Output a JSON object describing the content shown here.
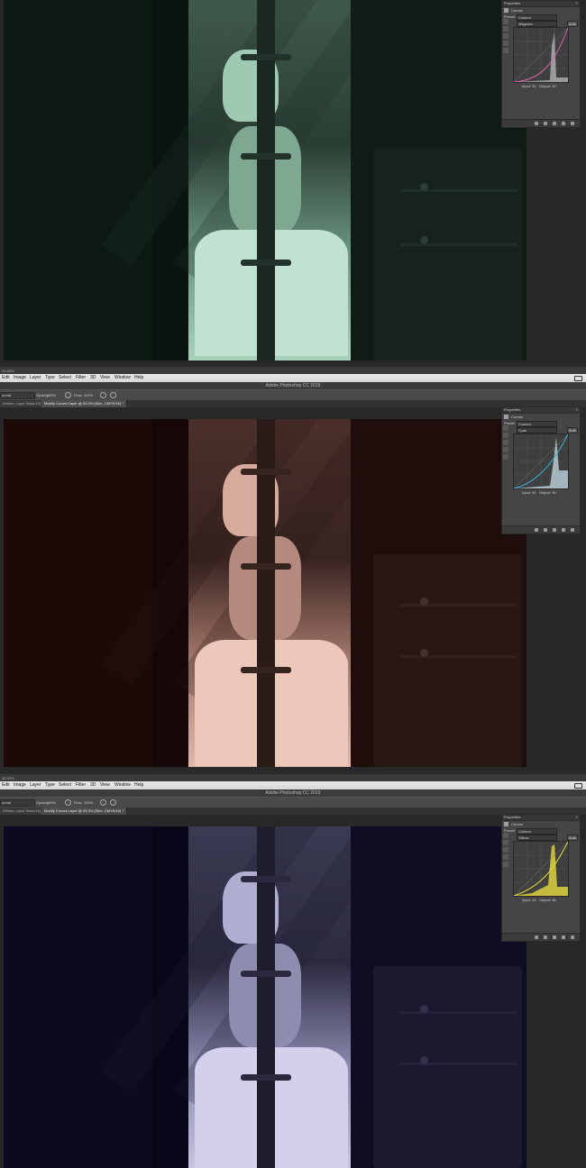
{
  "app": {
    "title": "Adobe Photoshop CC 2015"
  },
  "menu": [
    "Edit",
    "Image",
    "Layer",
    "Type",
    "Select",
    "Filter",
    "3D",
    "View",
    "Window",
    "Help"
  ],
  "options_bar": {
    "mode": "ormal",
    "opacity_label": "Opacity:",
    "opacity_value": "100%",
    "flow_label": "Flow:",
    "flow_value": "100%"
  },
  "tabs": [
    "Whiteo, Layer Mask/16) *",
    "Modify Curves Layer @ 33.3% (Skin, CMYK/16) *"
  ],
  "status": {
    "zoom": "33.33%"
  },
  "properties_panel": {
    "title": "Properties",
    "adjustment": "Curves",
    "preset_label": "Preset:",
    "preset_value": "Custom",
    "auto_label": "Auto",
    "input_label": "Input:",
    "output_label": "Output:"
  },
  "frames": [
    {
      "name": "magenta-curve",
      "channel": "Magenta",
      "input_value": "91",
      "output_value": "39",
      "tint": "#0e1e17",
      "highlight": "#8fc3a6",
      "curve_color": "#d864a8"
    },
    {
      "name": "cyan-curve",
      "channel": "Cyan",
      "input_value": "91",
      "output_value": "39",
      "tint": "#1b0a08",
      "highlight": "#d9a99a",
      "curve_color": "#3ab3d9"
    },
    {
      "name": "yellow-curve",
      "channel": "Yellow",
      "input_value": "40",
      "output_value": "36",
      "tint": "#0c0a1d",
      "highlight": "#b8b5d6",
      "curve_color": "#e6dc3c"
    }
  ]
}
